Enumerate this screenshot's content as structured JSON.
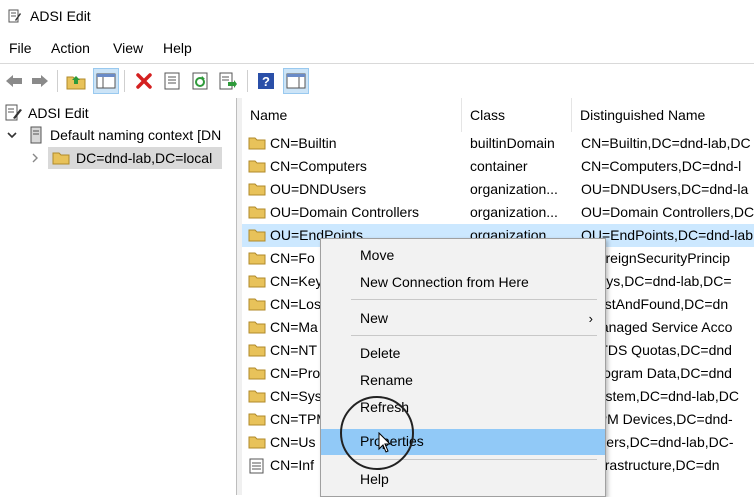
{
  "window": {
    "title": "ADSI Edit"
  },
  "menu": [
    "File",
    "Action",
    "View",
    "Help"
  ],
  "toolbar": {
    "buttons": [
      "back-arrow-icon",
      "forward-arrow-icon",
      "up-folder-icon",
      "show-hide-tree-icon",
      "delete-icon",
      "properties-icon",
      "refresh-icon",
      "export-list-icon",
      "help-icon",
      "show-hide-action-pane-icon"
    ]
  },
  "tree": {
    "root": "ADSI Edit",
    "context": "Default naming context [DN",
    "domain": "DC=dnd-lab,DC=local"
  },
  "list": {
    "columns": [
      "Name",
      "Class",
      "Distinguished Name"
    ],
    "rows": [
      {
        "name": "CN=Builtin",
        "class": "builtinDomain",
        "dn": "CN=Builtin,DC=dnd-lab,DC"
      },
      {
        "name": "CN=Computers",
        "class": "container",
        "dn": "CN=Computers,DC=dnd-l"
      },
      {
        "name": "OU=DNDUsers",
        "class": "organization...",
        "dn": "OU=DNDUsers,DC=dnd-la"
      },
      {
        "name": "OU=Domain Controllers",
        "class": "organization...",
        "dn": "OU=Domain Controllers,DC"
      },
      {
        "name": "OU=EndPoints",
        "class": "organization...",
        "dn": "OU=EndPoints,DC=dnd-lab"
      },
      {
        "name": "CN=Fo",
        "class": "",
        "dn": "=ForeignSecurityPrincip"
      },
      {
        "name": "CN=Key",
        "class": "",
        "dn": "=Keys,DC=dnd-lab,DC="
      },
      {
        "name": "CN=Los",
        "class": "",
        "dn": "=LostAndFound,DC=dn"
      },
      {
        "name": "CN=Ma",
        "class": "",
        "dn": "=Managed Service Acco"
      },
      {
        "name": "CN=NT",
        "class": "",
        "dn": "=NTDS Quotas,DC=dnd"
      },
      {
        "name": "CN=Pro",
        "class": "",
        "dn": "=Program Data,DC=dnd"
      },
      {
        "name": "CN=Sys",
        "class": "",
        "dn": "=System,DC=dnd-lab,DC"
      },
      {
        "name": "CN=TPM",
        "class": "",
        "dn": "=TPM Devices,DC=dnd-"
      },
      {
        "name": "CN=Us",
        "class": "",
        "dn": "=Users,DC=dnd-lab,DC-"
      },
      {
        "name": "CN=Inf",
        "class": "",
        "dn": "=Infrastructure,DC=dn"
      }
    ]
  },
  "context_menu": {
    "move": "Move",
    "new_connection": "New Connection from Here",
    "new": "New",
    "delete": "Delete",
    "rename": "Rename",
    "refresh": "Refresh",
    "properties": "Properties",
    "help": "Help"
  },
  "colors": {
    "selection": "#cce8ff",
    "menu_highlight": "#91c9f7",
    "folder": "#e8c25a"
  }
}
